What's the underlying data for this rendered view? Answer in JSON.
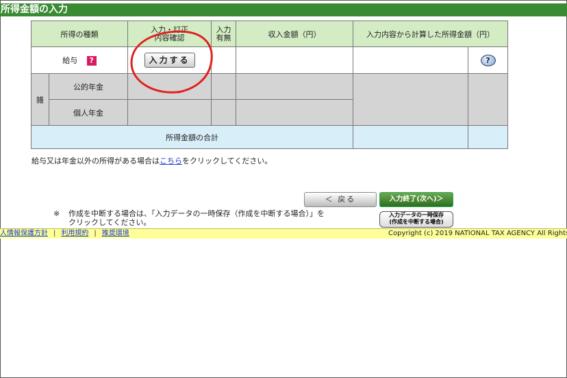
{
  "title": "所得金額の入力",
  "table": {
    "headers": {
      "type": "所得の種類",
      "confirm": "入力・訂正\n内容確認",
      "presence": "入力\n有無",
      "revenue": "収入金額（円）",
      "income": "入力内容から計算した所得金額（円）"
    },
    "salary_label": "給与",
    "help_icon_char": "?",
    "enter_button": "入力する",
    "misc_label": "雑",
    "public_pension": "公的年金",
    "private_pension": "個人年金",
    "total_label": "所得金額の合計",
    "info_icon_char": "?"
  },
  "note": {
    "before": "給与又は年金以外の所得がある場合は",
    "link": "こちら",
    "after": "をクリックしてください。"
  },
  "buttons": {
    "back": "＜ 戻る",
    "next": "入力終了(次へ)＞",
    "save_line1": "入力データの一時保存",
    "save_line2": "(作成を中断する場合)"
  },
  "suspend": {
    "mark": "※",
    "text": "作成を中断する場合は、「入力データの一時保存（作成を中断する場合）」を\nクリックしてください。"
  },
  "footer": {
    "privacy": "人情報保護方針",
    "terms": "利用規約",
    "env": "推奨環境",
    "copyright": "Copyright (c) 2019 NATIONAL TAX AGENCY All Rights"
  },
  "colors": {
    "title_bg": "#3a8a33",
    "header_bg": "#d4ecc4",
    "total_bg": "#d8eef8",
    "annotation": "#e02020"
  }
}
